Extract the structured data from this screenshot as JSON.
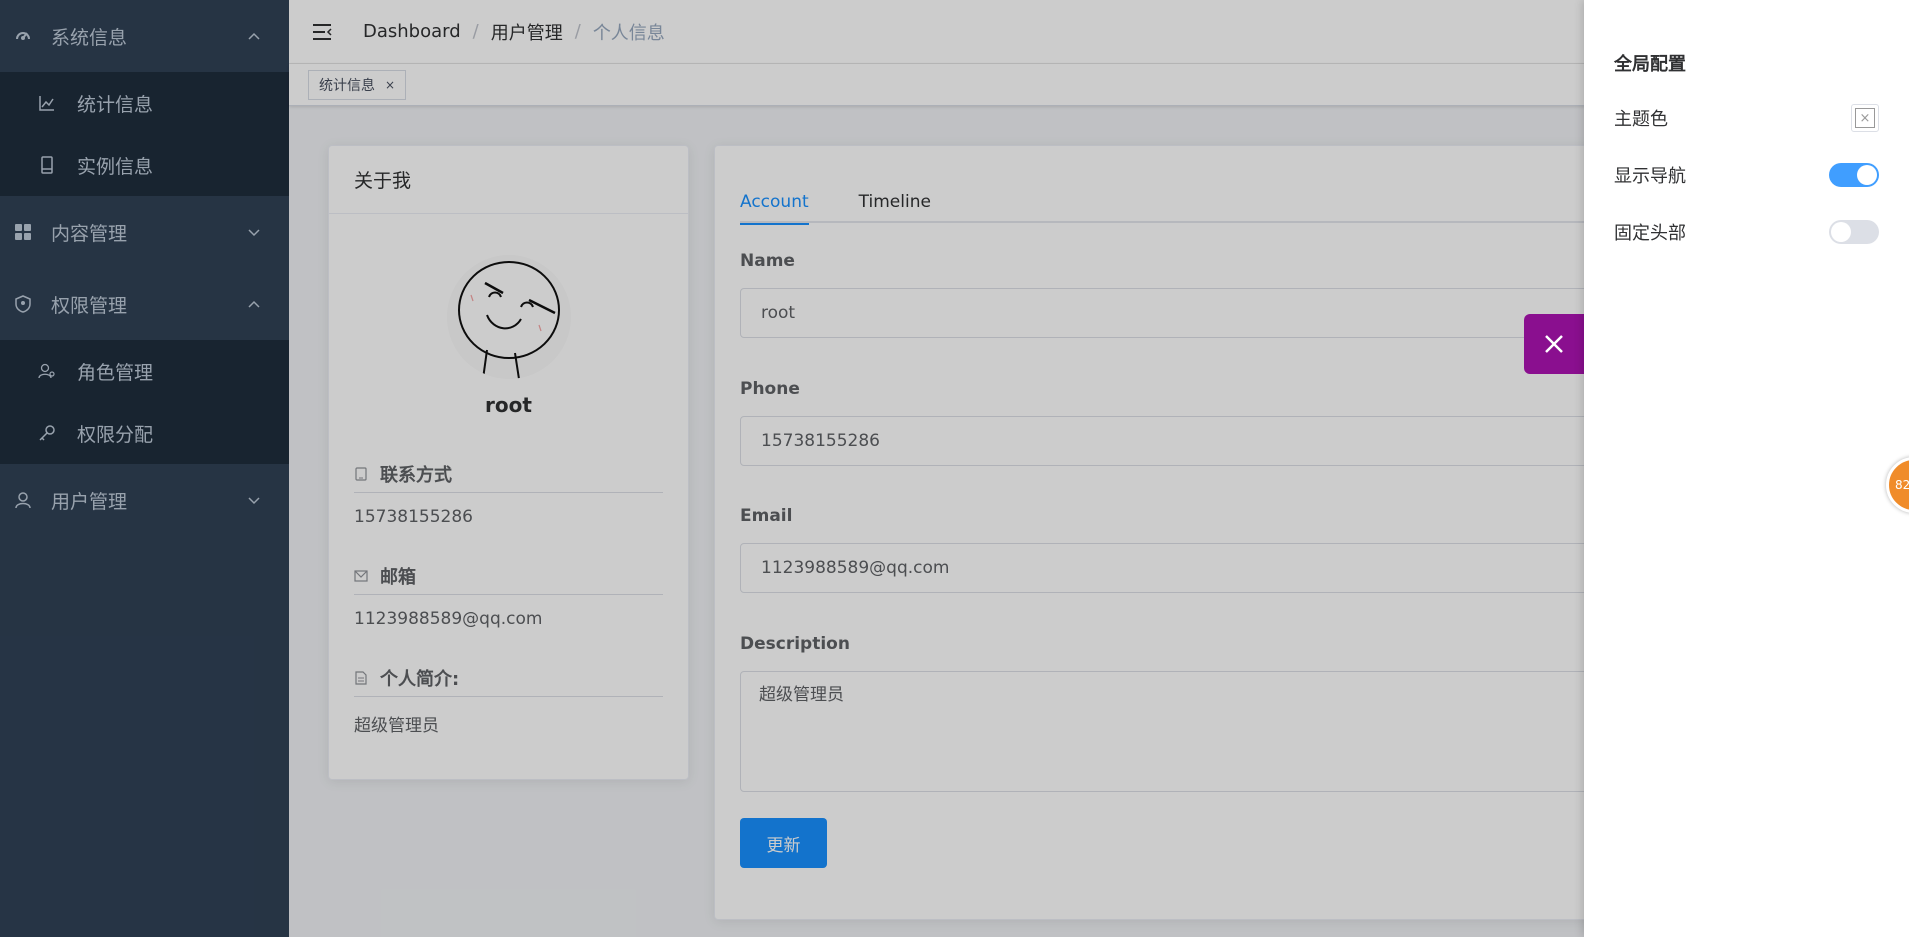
{
  "sidebar": {
    "groups": [
      {
        "label": "系统信息",
        "icon": "dashboard-icon",
        "expanded": true,
        "items": [
          {
            "label": "统计信息",
            "icon": "chart-line-icon"
          },
          {
            "label": "实例信息",
            "icon": "tablet-icon"
          }
        ]
      },
      {
        "label": "内容管理",
        "icon": "grid-icon",
        "expanded": false,
        "items": []
      },
      {
        "label": "权限管理",
        "icon": "shield-icon",
        "expanded": true,
        "items": [
          {
            "label": "角色管理",
            "icon": "user-role-icon"
          },
          {
            "label": "权限分配",
            "icon": "key-icon"
          }
        ]
      },
      {
        "label": "用户管理",
        "icon": "user-icon",
        "expanded": false,
        "items": []
      }
    ]
  },
  "navbar": {
    "breadcrumb": {
      "first": "Dashboard",
      "second": "用户管理",
      "current": "个人信息",
      "separator": "/"
    }
  },
  "tags": [
    {
      "label": "统计信息",
      "close": "×"
    }
  ],
  "about": {
    "header": "关于我",
    "username": "root",
    "contact_title": "联系方式",
    "contact_value": "15738155286",
    "email_title": "邮箱",
    "email_value": "1123988589@qq.com",
    "bio_title": "个人简介:",
    "bio_value": "超级管理员"
  },
  "account": {
    "tabs": [
      {
        "label": "Account",
        "active": true
      },
      {
        "label": "Timeline",
        "active": false
      }
    ],
    "name_label": "Name",
    "name_value": "root",
    "phone_label": "Phone",
    "phone_value": "15738155286",
    "email_label": "Email",
    "email_value": "1123988589@qq.com",
    "description_label": "Description",
    "description_value": "超级管理员",
    "update_label": "更新"
  },
  "drawer": {
    "title": "全局配置",
    "theme_color_label": "主题色",
    "show_nav_label": "显示导航",
    "show_nav_on": true,
    "fixed_header_label": "固定头部",
    "fixed_header_on": false
  },
  "float_badge": "82",
  "colors": {
    "sidebar_bg": "#304156",
    "submenu_bg": "#1f2d3d",
    "accent": "#1890ff",
    "drawer_close_bg": "#8a0f8f",
    "badge": "#f08c2a"
  }
}
